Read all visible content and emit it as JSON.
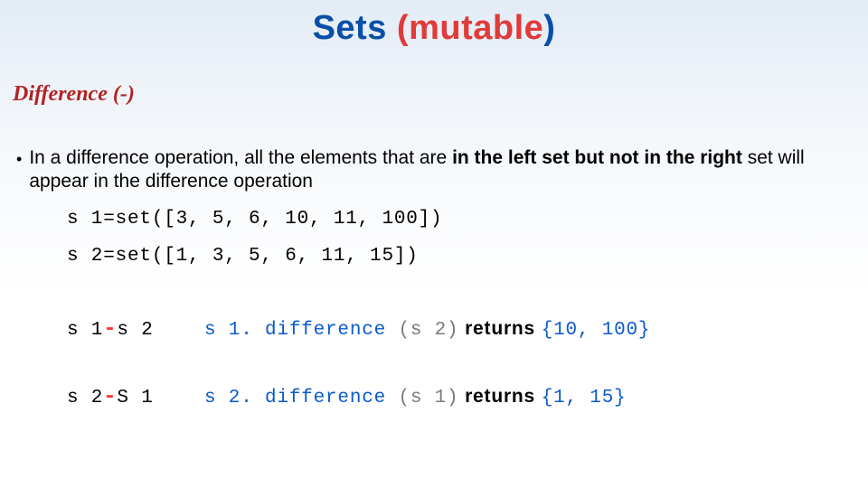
{
  "title": {
    "word1": "Sets ",
    "open_paren": "(",
    "mutable": "mutable",
    "close_paren": ")"
  },
  "subtitle": "Difference (-)",
  "bullet": {
    "pre": "In a difference operation, all the elements that are ",
    "bold1": "in the left set but not in the right",
    "post": " set will appear in the difference operation"
  },
  "code1": "s 1=set([3, 5, 6, 10, 11, 100])",
  "code2": "s 2=set([1, 3, 5, 6, 11, 15])",
  "ex1": {
    "lhs_a": "s 1",
    "lhs_b": "s 2",
    "method": "s 1. difference ",
    "arg": "(s 2)",
    "returns": " returns ",
    "result": "{10, 100}"
  },
  "ex2": {
    "lhs_a": "s 2",
    "lhs_b": "S 1",
    "method": "s 2. difference ",
    "arg": "(s 1)",
    "returns": " returns ",
    "result": "{1, 15}"
  }
}
